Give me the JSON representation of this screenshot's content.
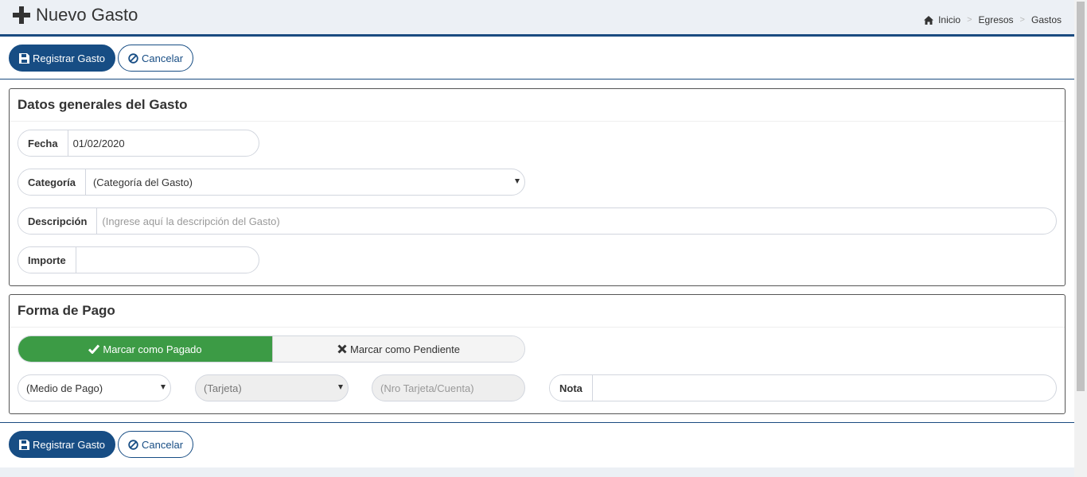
{
  "header": {
    "title": "Nuevo Gasto",
    "breadcrumb": [
      "Inicio",
      "Egresos",
      "Gastos"
    ],
    "breadcrumb_sep": ">"
  },
  "actions": {
    "save_label": "Registrar Gasto",
    "cancel_label": "Cancelar"
  },
  "general": {
    "title": "Datos generales del Gasto",
    "fecha_label": "Fecha",
    "fecha_value": "01/02/2020",
    "categoria_label": "Categoría",
    "categoria_value": "(Categoría del Gasto)",
    "descripcion_label": "Descripción",
    "descripcion_placeholder": "(Ingrese aquí la descripción del Gasto)",
    "importe_label": "Importe",
    "importe_value": ""
  },
  "payment": {
    "title": "Forma de Pago",
    "paid_label": "Marcar como Pagado",
    "pending_label": "Marcar como Pendiente",
    "medio_value": "(Medio de Pago)",
    "tarjeta_value": "(Tarjeta)",
    "nro_placeholder": "(Nro Tarjeta/Cuenta)",
    "nota_label": "Nota",
    "nota_value": ""
  },
  "colors": {
    "primary": "#174d84",
    "success": "#3c9b45",
    "background": "#ecf0f5"
  },
  "icons": [
    "plus-icon",
    "home-icon",
    "save-icon",
    "ban-icon",
    "check-icon",
    "times-icon",
    "chevron-down-icon"
  ]
}
